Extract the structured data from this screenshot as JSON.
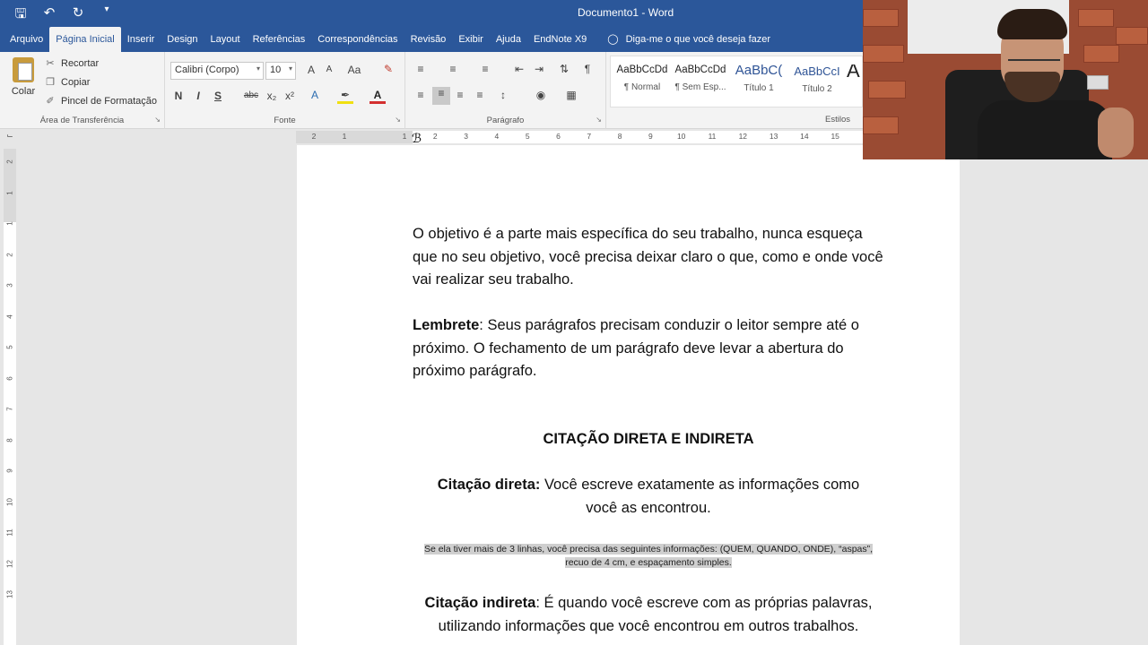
{
  "titlebar": {
    "document_title": "Documento1  -  Word",
    "qat": [
      "save-icon",
      "undo-icon",
      "redo-icon",
      "customize-icon"
    ]
  },
  "tabs": [
    "Arquivo",
    "Página Inicial",
    "Inserir",
    "Design",
    "Layout",
    "Referências",
    "Correspondências",
    "Revisão",
    "Exibir",
    "Ajuda",
    "EndNote X9"
  ],
  "active_tab": "Página Inicial",
  "tell_me": "Diga-me o que você deseja fazer",
  "clipboard": {
    "paste": "Colar",
    "cut": "Recortar",
    "copy": "Copiar",
    "format_painter": "Pincel de Formatação",
    "label": "Área de Transferência"
  },
  "font": {
    "family": "Calibri (Corpo)",
    "size": "10",
    "label": "Fonte",
    "grow": "A",
    "shrink": "A",
    "case": "Aa",
    "bold": "N",
    "italic": "I",
    "underline": "S",
    "strike": "abc",
    "subscript": "x₂",
    "superscript": "x²"
  },
  "paragraph": {
    "label": "Parágrafo"
  },
  "styles": {
    "label": "Estilos",
    "items": [
      {
        "sample": "AaBbCcDd",
        "name": "¶ Normal"
      },
      {
        "sample": "AaBbCcDd",
        "name": "¶ Sem Esp..."
      },
      {
        "sample": "AaBbC(",
        "name": "Título 1"
      },
      {
        "sample": "AaBbCcI",
        "name": "Título 2"
      },
      {
        "sample": "A",
        "name": ""
      }
    ]
  },
  "ruler": {
    "left_numbers": [
      "2",
      "1"
    ],
    "numbers": [
      "1",
      "2",
      "3",
      "4",
      "5",
      "6",
      "7",
      "8",
      "9",
      "10",
      "11",
      "12",
      "13",
      "14",
      "15"
    ],
    "vertical_numbers": [
      "2",
      "1",
      "1",
      "2",
      "3",
      "4",
      "5",
      "6",
      "7",
      "8",
      "9",
      "10",
      "11",
      "12",
      "13"
    ]
  },
  "document": {
    "p1": "O objetivo é a parte mais específica do seu trabalho, nunca esqueça que no seu objetivo, você precisa deixar claro o que, como e onde você vai realizar seu trabalho.",
    "p2_bold": "Lembrete",
    "p2_rest": ": Seus parágrafos precisam conduzir o leitor sempre até o próximo. O fechamento de um parágrafo deve levar a abertura do próximo parágrafo.",
    "heading": "CITAÇÃO DIRETA E INDIRETA",
    "p3_bold": "Citação direta:",
    "p3_rest": " Você escreve exatamente as informações como você as encontrou.",
    "note_line1": "Se ela tiver mais de 3 linhas, você precisa das seguintes informações: (QUEM, QUANDO, ONDE), “aspas”,",
    "note_line2": "recuo de 4 cm, e espaçamento simples.",
    "p4_bold": "Citação indireta",
    "p4_rest": ": É quando você escreve com as próprias palavras, utilizando informações que você encontrou em outros trabalhos."
  }
}
